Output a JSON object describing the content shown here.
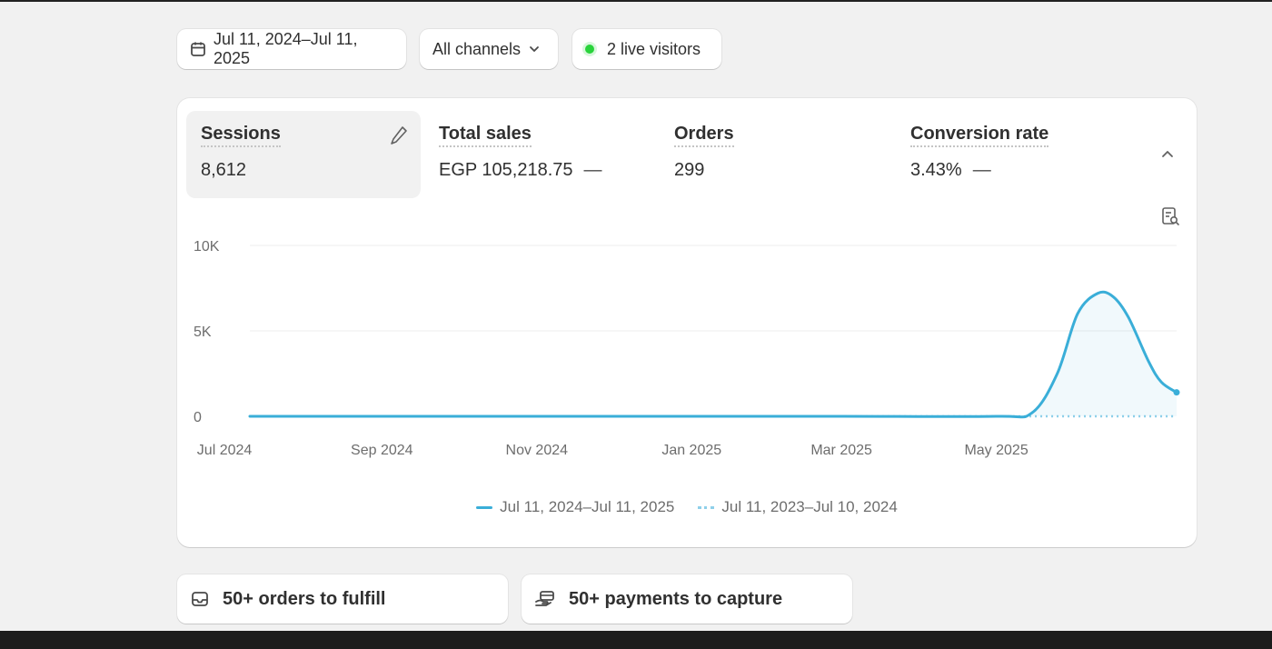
{
  "filters": {
    "date_range": "Jul 11, 2024–Jul 11, 2025",
    "channels": "All channels",
    "live_visitors": "2 live visitors"
  },
  "metrics": [
    {
      "label": "Sessions",
      "value": "8,612",
      "active": true
    },
    {
      "label": "Total sales",
      "value": "EGP 105,218.75",
      "trend": "—"
    },
    {
      "label": "Orders",
      "value": "299"
    },
    {
      "label": "Conversion rate",
      "value": "3.43%",
      "trend": "—"
    }
  ],
  "chart_data": {
    "type": "line",
    "x_tick_labels": [
      "Jul 2024",
      "Sep 2024",
      "Nov 2024",
      "Jan 2025",
      "Mar 2025",
      "May 2025"
    ],
    "y_tick_labels": [
      "10K",
      "5K",
      "0"
    ],
    "ylim": [
      0,
      10000
    ],
    "grid": true,
    "legend": "bottom-center",
    "series": [
      {
        "name": "Jul 11, 2024–Jul 11, 2025",
        "style": "solid",
        "color": "#3aaed8",
        "points": [
          [
            "2024-07-11",
            0
          ],
          [
            "2024-09-01",
            0
          ],
          [
            "2024-11-01",
            0
          ],
          [
            "2025-01-01",
            0
          ],
          [
            "2025-03-01",
            0
          ],
          [
            "2025-05-01",
            0
          ],
          [
            "2025-05-15",
            200
          ],
          [
            "2025-05-25",
            2500
          ],
          [
            "2025-06-02",
            6000
          ],
          [
            "2025-06-10",
            7200
          ],
          [
            "2025-06-16",
            7000
          ],
          [
            "2025-06-22",
            5800
          ],
          [
            "2025-06-30",
            3200
          ],
          [
            "2025-07-05",
            2000
          ],
          [
            "2025-07-11",
            1400
          ]
        ]
      },
      {
        "name": "Jul 11, 2023–Jul 10, 2024",
        "style": "dotted",
        "color": "#8fd0ea",
        "points": [
          [
            "2024-07-11",
            0
          ],
          [
            "2025-07-11",
            0
          ]
        ]
      }
    ]
  },
  "tasks": [
    {
      "label": "50+ orders to fulfill",
      "icon": "inbox-icon"
    },
    {
      "label": "50+ payments to capture",
      "icon": "payments-icon"
    }
  ]
}
